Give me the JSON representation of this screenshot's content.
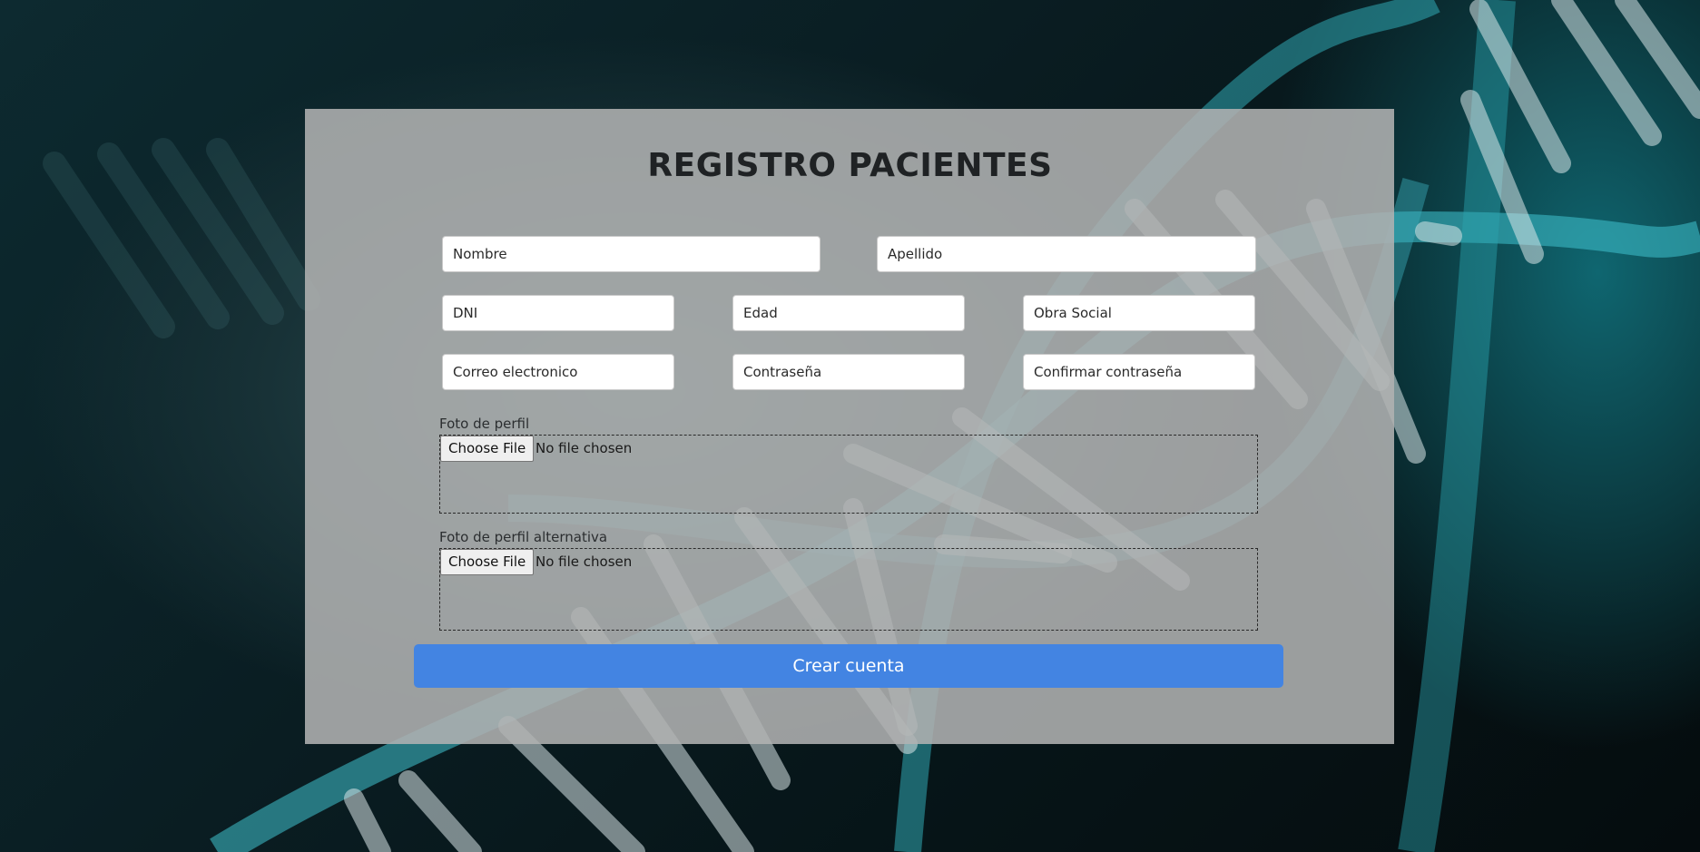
{
  "form": {
    "title": "REGISTRO PACIENTES",
    "fields": {
      "nombre_placeholder": "Nombre",
      "apellido_placeholder": "Apellido",
      "dni_placeholder": "DNI",
      "edad_placeholder": "Edad",
      "obra_social_placeholder": "Obra Social",
      "correo_placeholder": "Correo electronico",
      "contrasena_placeholder": "Contraseña",
      "confirmar_placeholder": "Confirmar contraseña"
    },
    "foto_perfil": {
      "label": "Foto de perfil",
      "button": "Choose File",
      "status": "No file chosen"
    },
    "foto_alternativa": {
      "label": "Foto de perfil alternativa",
      "button": "Choose File",
      "status": "No file chosen"
    },
    "submit_label": "Crear cuenta"
  },
  "colors": {
    "accent": "#4384e2",
    "card": "#b0b2b2",
    "background": "#0a1d22"
  }
}
